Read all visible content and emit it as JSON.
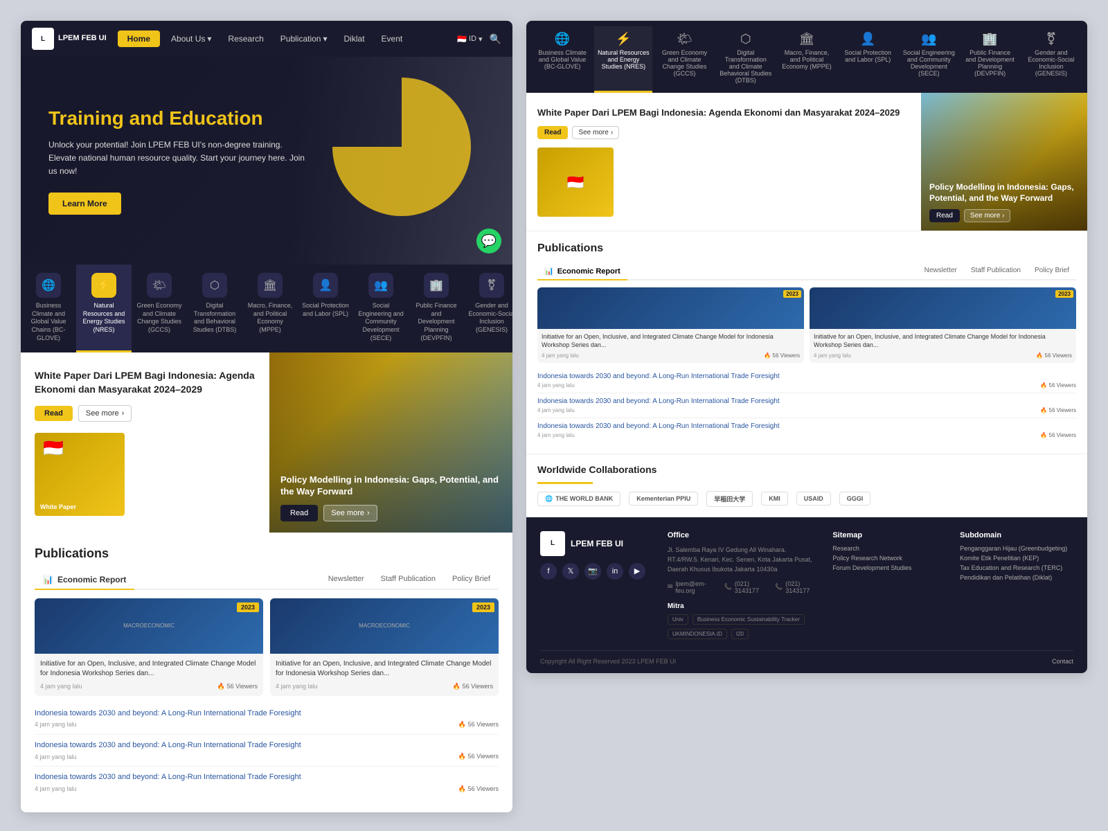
{
  "site": {
    "logo_text": "LPEM FEB UI",
    "logo_short": "L"
  },
  "navbar": {
    "home_label": "Home",
    "about_label": "About Us",
    "research_label": "Research",
    "publication_label": "Publication",
    "diklat_label": "Diklat",
    "event_label": "Event",
    "lang_label": "ID"
  },
  "hero": {
    "title": "Training and Education",
    "subtitle": "Unlock your potential! Join LPEM FEB UI's non-degree training. Elevate national human resource quality. Start your journey here. Join us now!",
    "btn_label": "Learn More"
  },
  "categories": [
    {
      "id": "bc-glove",
      "icon": "🌐",
      "label": "Business Climate and Global Value Chains (BC-GLOVE)"
    },
    {
      "id": "nres",
      "icon": "⚡",
      "label": "Natural Resources and Energy Studies (NRES)",
      "active": true
    },
    {
      "id": "gccs",
      "icon": "🌤",
      "label": "Green Economy and Climate Change Studies (GCCS)"
    },
    {
      "id": "dtbs",
      "icon": "⬡",
      "label": "Digital Transformation and Behavioral Studies (DTBS)"
    },
    {
      "id": "mppe",
      "icon": "🏛",
      "label": "Macro, Finance, and Political Economy (MPPE)"
    },
    {
      "id": "spl",
      "icon": "👤",
      "label": "Social Protection and Labor (SPL)"
    },
    {
      "id": "sece",
      "icon": "👥",
      "label": "Social Engineering and Community Development (SECE)"
    },
    {
      "id": "devpfin",
      "icon": "🏢",
      "label": "Public Finance and Development Planning (DEVPFIN)"
    },
    {
      "id": "genesis",
      "icon": "⚧",
      "label": "Gender and Economic-Social Inclusion (GENESIS)"
    }
  ],
  "white_paper": {
    "title": "White Paper Dari LPEM Bagi Indonesia: Agenda Ekonomi dan Masyarakat 2024–2029",
    "read_label": "Read",
    "see_more_label": "See more"
  },
  "policy_modelling": {
    "title": "Policy Modelling in Indonesia: Gaps, Potential, and the Way Forward",
    "read_label": "Read",
    "see_more_label": "See more"
  },
  "publications": {
    "section_title": "Publications",
    "active_tab": "Economic Report",
    "tabs": [
      "Newsletter",
      "Staff Publication",
      "Policy Brief"
    ],
    "cards": [
      {
        "badge": "2023",
        "desc": "Initiative for an Open, Inclusive, and Integrated Climate Change Model for Indonesia Workshop Series dan...",
        "time": "4 jam yang lalu",
        "views": "56 Viewers"
      },
      {
        "badge": "2023",
        "desc": "Initiative for an Open, Inclusive, and Integrated Climate Change Model for Indonesia Workshop Series dan...",
        "time": "4 jam yang lalu",
        "views": "56 Viewers"
      }
    ],
    "list_items": [
      {
        "title": "Indonesia towards 2030 and beyond: A Long-Run International Trade Foresight",
        "time": "4 jam yang lalu",
        "views": "56 Viewers"
      },
      {
        "title": "Indonesia towards 2030 and beyond: A Long-Run International Trade Foresight",
        "time": "4 jam yang lalu",
        "views": "56 Viewers"
      },
      {
        "title": "Indonesia towards 2030 and beyond: A Long-Run International Trade Foresight",
        "time": "4 jam yang lalu",
        "views": "56 Viewers"
      }
    ]
  },
  "collaborations": {
    "title": "Worldwide Collaborations",
    "logos": [
      "THE WORLD BANK",
      "Kementerian PPIU",
      "早稲田大学",
      "KMI",
      "USAID",
      "GGGI"
    ]
  },
  "footer": {
    "office_title": "Office",
    "office_address": "Jl. Salemba Raya IV Gedung All Winahara. RT.4/RW.5. Kenari, Kec. Senen, Kota Jakarta Pusat, Daerah Khusus Ibukota Jakarta 10430a",
    "email": "lpem@em-feu.org",
    "phone1": "(021) 3143177",
    "phone2": "(021) 3143177",
    "sitemap_title": "Sitemap",
    "sitemap_links": [
      "Research",
      "Policy Research Network",
      "Forum Development Studies"
    ],
    "subdomain_title": "Subdomain",
    "subdomain_links": [
      "Penganggaran Hijau (Greenbudgeting)",
      "Komite Etik Penelitian (KEP)",
      "Tax Education and Research (TERC)",
      "Pendidikan dan Pelatihan (Diklat)"
    ],
    "mitra_title": "Mitra",
    "mitra_logos": [
      "Univ Logo",
      "Business Economic Sustainability Tracker",
      "UKMINDONESIA.ID",
      "I20"
    ],
    "copyright": "Copyright All Right Reserved 2023 LPEM FEB UI",
    "contact_label": "Contact"
  }
}
